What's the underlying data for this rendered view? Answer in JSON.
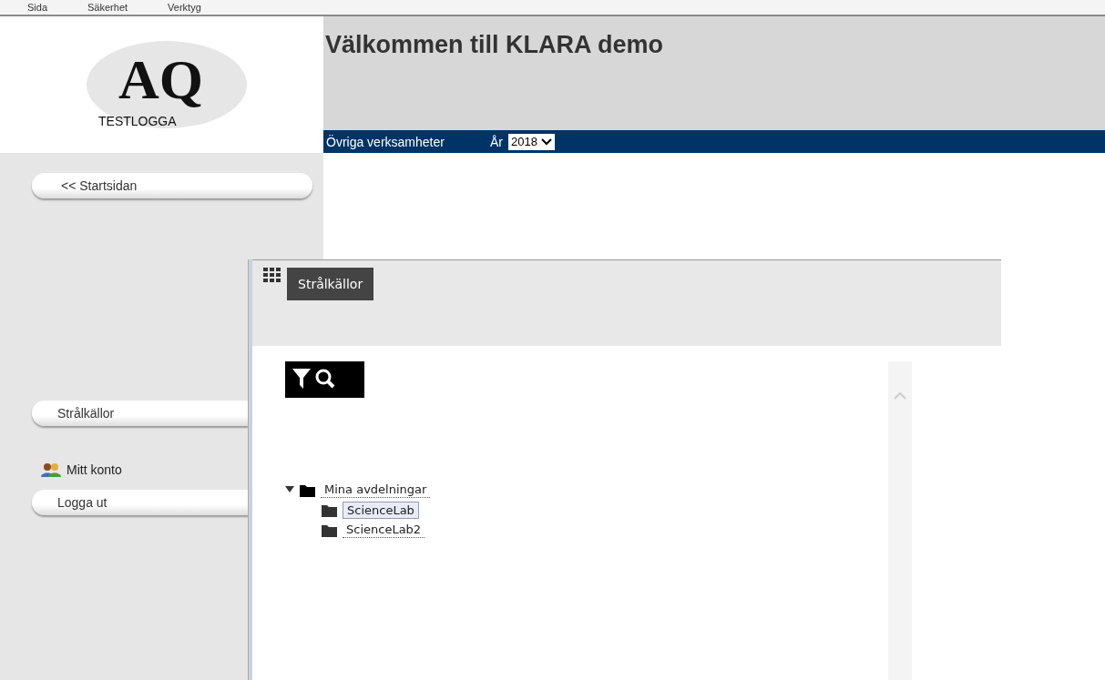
{
  "toolbar": {
    "items": [
      "Sida",
      "Säkerhet",
      "Verktyg"
    ]
  },
  "logo": {
    "mark": "AQ",
    "caption": "TESTLOGGA"
  },
  "header": {
    "title": "Välkommen till KLARA demo",
    "org": "Övriga verksamheter",
    "year_label": "År",
    "year": "2018"
  },
  "sidebar": {
    "items": [
      {
        "kind": "button",
        "label": "<< Startsidan"
      },
      {
        "kind": "button",
        "label": "Strålkällor"
      },
      {
        "kind": "link",
        "label": "Mitt konto"
      },
      {
        "kind": "button",
        "label": "Logga ut"
      }
    ]
  },
  "panel": {
    "tab": "Strålkällor",
    "tree": [
      {
        "label": "Mina avdelningar",
        "expanded": true,
        "selected": false,
        "children": [
          {
            "label": "ScienceLab",
            "selected": true
          },
          {
            "label": "ScienceLab2",
            "selected": false
          }
        ]
      }
    ]
  }
}
